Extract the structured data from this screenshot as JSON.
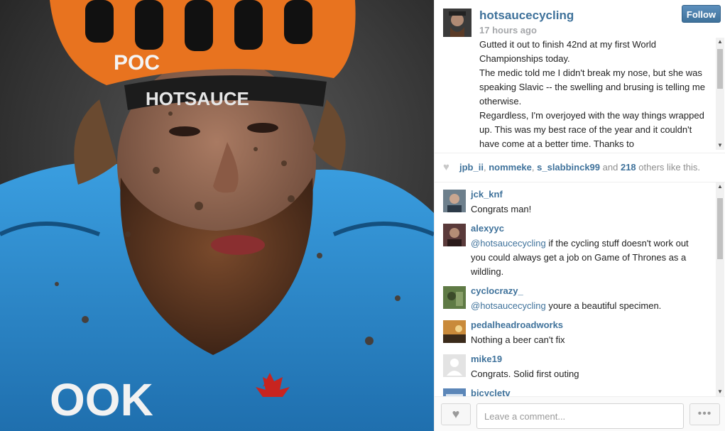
{
  "post": {
    "username": "hotsaucecycling",
    "time": "17 hours ago",
    "follow_label": "Follow",
    "caption": [
      "Gutted it out to finish 42nd at my first World Championships today.",
      "The medic told me I didn't break my nose, but she was speaking Slavic -- the swelling and brusing is telling me otherwise.",
      "Regardless, I'm overjoyed with the way things wrapped up. This was my best race of the year and it couldn't have come at a better time. Thanks to"
    ]
  },
  "likes": {
    "users": [
      "jpb_ii",
      "nommeke",
      "s_slabbinck99"
    ],
    "and_word": "and",
    "count": "218",
    "suffix": "others like this."
  },
  "comments": [
    {
      "user": "jck_knf",
      "mention": "",
      "text": "Congrats man!",
      "avatar_color": "#6d7f8c"
    },
    {
      "user": "alexyyc",
      "mention": "@hotsaucecycling",
      "text": " if the cycling stuff doesn't work out you could always get a job on Game of Thrones as a wildling.",
      "avatar_color": "#5a3a3a"
    },
    {
      "user": "cyclocrazy_",
      "mention": "@hotsaucecycling",
      "text": " youre a beautiful specimen.",
      "avatar_color": "#5f7a45"
    },
    {
      "user": "pedalheadroadworks",
      "mention": "",
      "text": "Nothing a beer can't fix",
      "avatar_color": "#c98a3a"
    },
    {
      "user": "mike19",
      "mention": "",
      "text": "Congrats. Solid first outing",
      "avatar_color": "#d8d8d8"
    },
    {
      "user": "bicycletv",
      "mention": "",
      "text": "",
      "avatar_color": "#5b86b8"
    }
  ],
  "footer": {
    "comment_placeholder": "Leave a comment...",
    "more_label": "•••"
  },
  "photo": {
    "jersey_text": "OOK",
    "headband_text": "HOTSAUCE",
    "helmet_text": "POC"
  },
  "colors": {
    "link_blue": "#3f729b",
    "muted_gray": "#a5a7aa",
    "helmet_orange": "#e8731f",
    "jersey_blue": "#2e8fd4"
  }
}
